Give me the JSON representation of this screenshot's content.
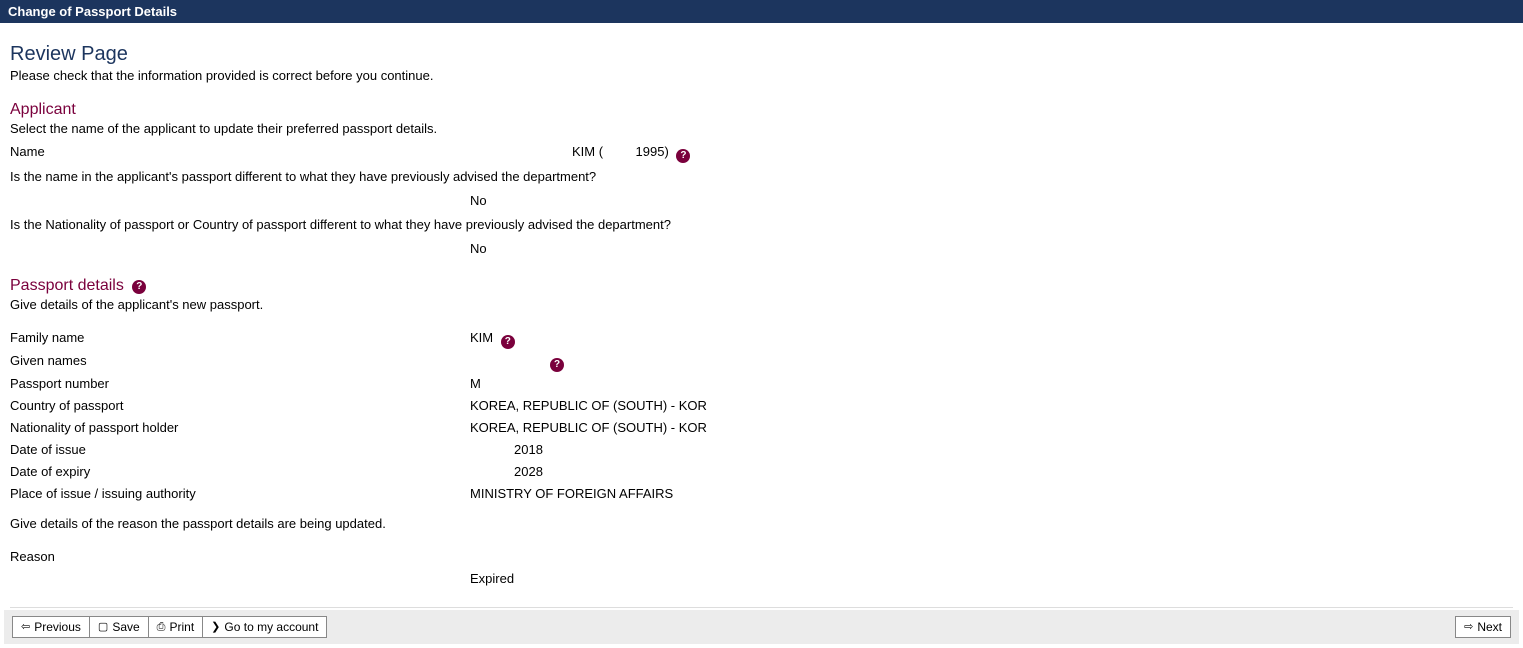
{
  "title_bar": "Change of Passport Details",
  "page": {
    "heading": "Review Page",
    "intro": "Please check that the information provided is correct before you continue."
  },
  "applicant": {
    "heading": "Applicant",
    "intro": "Select the name of the applicant to update their preferred passport details.",
    "name_label": "Name",
    "name_value": "KIM (         1995)",
    "q1": "Is the name in the applicant's passport different to what they have previously advised the department?",
    "q1_answer": "No",
    "q2": "Is the Nationality of passport or Country of passport different to what they have previously advised the department?",
    "q2_answer": "No"
  },
  "passport": {
    "heading": "Passport details",
    "intro": "Give details of the applicant's new passport.",
    "family_name_label": "Family name",
    "family_name_value": "KIM",
    "given_names_label": "Given names",
    "given_names_value": "",
    "passport_number_label": "Passport number",
    "passport_number_value": "M",
    "country_label": "Country of passport",
    "country_value": "KOREA, REPUBLIC OF (SOUTH) - KOR",
    "nationality_label": "Nationality of passport holder",
    "nationality_value": "KOREA, REPUBLIC OF (SOUTH) - KOR",
    "date_issue_label": "Date of issue",
    "date_issue_value": "2018",
    "date_expiry_label": "Date of expiry",
    "date_expiry_value": "2028",
    "place_issue_label": "Place of issue / issuing authority",
    "place_issue_value": "MINISTRY OF FOREIGN AFFAIRS"
  },
  "reason_section": {
    "intro": "Give details of the reason the passport details are being updated.",
    "reason_label": "Reason",
    "reason_value": "Expired"
  },
  "buttons": {
    "previous": "Previous",
    "save": "Save",
    "print": "Print",
    "account": "Go to my account",
    "next": "Next"
  },
  "icons": {
    "help": "?"
  }
}
